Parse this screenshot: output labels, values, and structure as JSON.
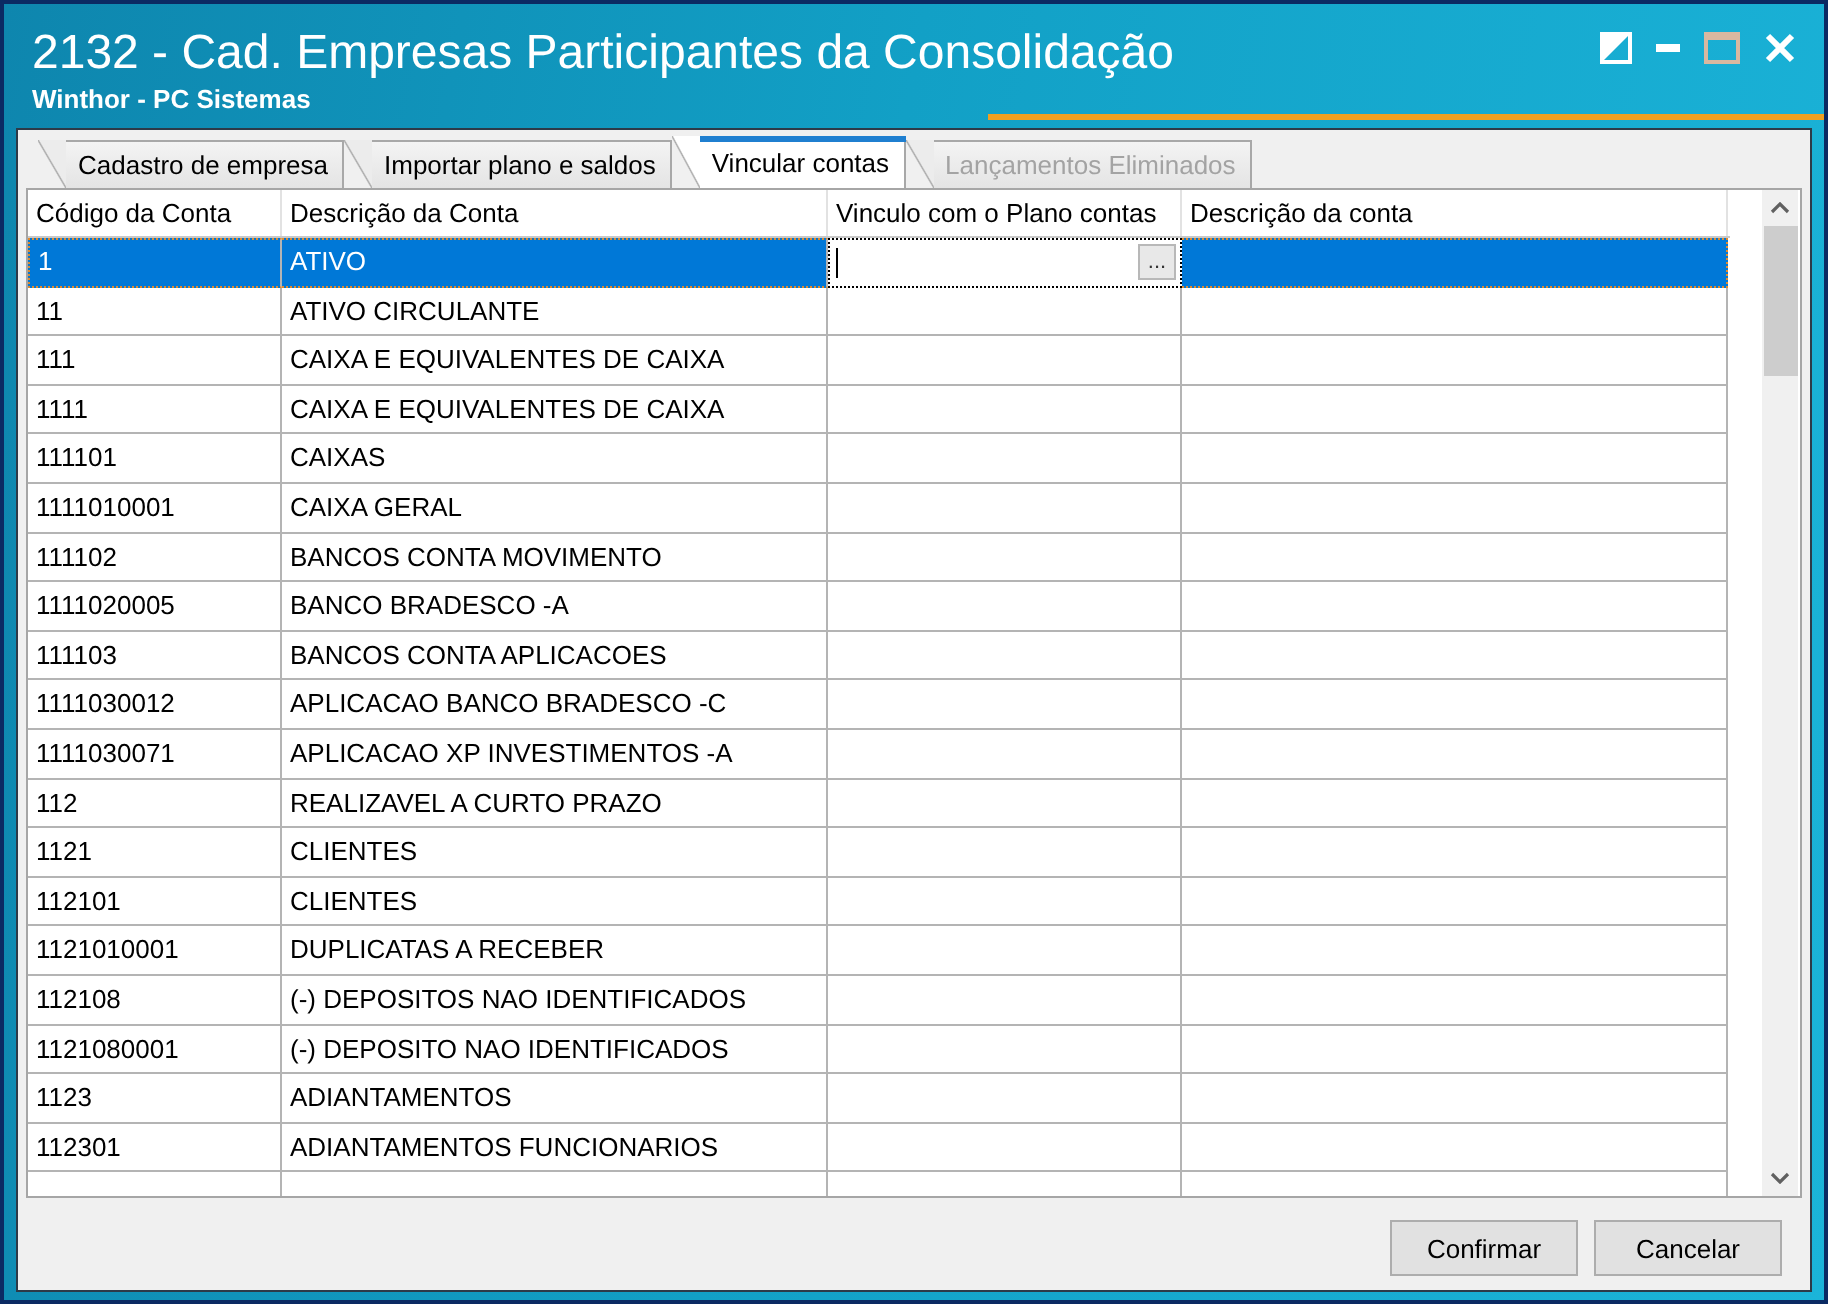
{
  "window": {
    "title": "2132 - Cad. Empresas Participantes da Consolidação",
    "subtitle": "Winthor - PC Sistemas"
  },
  "window_controls": [
    {
      "kind": "theme",
      "disabled": false
    },
    {
      "kind": "minimize",
      "disabled": false
    },
    {
      "kind": "maximize",
      "disabled": true
    },
    {
      "kind": "close",
      "disabled": false
    }
  ],
  "tabs": [
    {
      "label": "Cadastro de empresa",
      "selected": false,
      "disabled": false
    },
    {
      "label": "Importar plano e saldos",
      "selected": false,
      "disabled": false
    },
    {
      "label": "Vincular contas",
      "selected": true,
      "disabled": false
    },
    {
      "label": "Lançamentos Eliminados",
      "selected": false,
      "disabled": true
    }
  ],
  "table": {
    "columns": [
      "Código da Conta",
      "Descrição da Conta",
      "Vinculo com o Plano contas",
      "Descrição da conta"
    ],
    "lookup_button": "...",
    "rows": [
      {
        "code": "1",
        "description": "ATIVO",
        "selected": true,
        "editing": true
      },
      {
        "code": "11",
        "description": "ATIVO CIRCULANTE",
        "selected": false,
        "editing": false
      },
      {
        "code": "111",
        "description": "CAIXA E EQUIVALENTES DE CAIXA",
        "selected": false,
        "editing": false
      },
      {
        "code": "1111",
        "description": "CAIXA E EQUIVALENTES DE CAIXA",
        "selected": false,
        "editing": false
      },
      {
        "code": "111101",
        "description": "CAIXAS",
        "selected": false,
        "editing": false
      },
      {
        "code": "1111010001",
        "description": "CAIXA GERAL",
        "selected": false,
        "editing": false
      },
      {
        "code": "111102",
        "description": "BANCOS CONTA MOVIMENTO",
        "selected": false,
        "editing": false
      },
      {
        "code": "1111020005",
        "description": "BANCO BRADESCO -A",
        "selected": false,
        "editing": false
      },
      {
        "code": "111103",
        "description": "BANCOS CONTA APLICACOES",
        "selected": false,
        "editing": false
      },
      {
        "code": "1111030012",
        "description": "APLICACAO BANCO BRADESCO -C",
        "selected": false,
        "editing": false
      },
      {
        "code": "1111030071",
        "description": "APLICACAO XP INVESTIMENTOS -A",
        "selected": false,
        "editing": false
      },
      {
        "code": "112",
        "description": "REALIZAVEL A CURTO PRAZO",
        "selected": false,
        "editing": false
      },
      {
        "code": "1121",
        "description": "CLIENTES",
        "selected": false,
        "editing": false
      },
      {
        "code": "112101",
        "description": "CLIENTES",
        "selected": false,
        "editing": false
      },
      {
        "code": "1121010001",
        "description": "DUPLICATAS A RECEBER",
        "selected": false,
        "editing": false
      },
      {
        "code": "112108",
        "description": "(-) DEPOSITOS NAO IDENTIFICADOS",
        "selected": false,
        "editing": false
      },
      {
        "code": "1121080001",
        "description": "(-) DEPOSITO NAO IDENTIFICADOS",
        "selected": false,
        "editing": false
      },
      {
        "code": "1123",
        "description": "ADIANTAMENTOS",
        "selected": false,
        "editing": false
      },
      {
        "code": "112301",
        "description": "ADIANTAMENTOS FUNCIONARIOS",
        "selected": false,
        "editing": false
      }
    ]
  },
  "buttons": [
    {
      "label": "Confirmar"
    },
    {
      "label": "Cancelar"
    }
  ]
}
